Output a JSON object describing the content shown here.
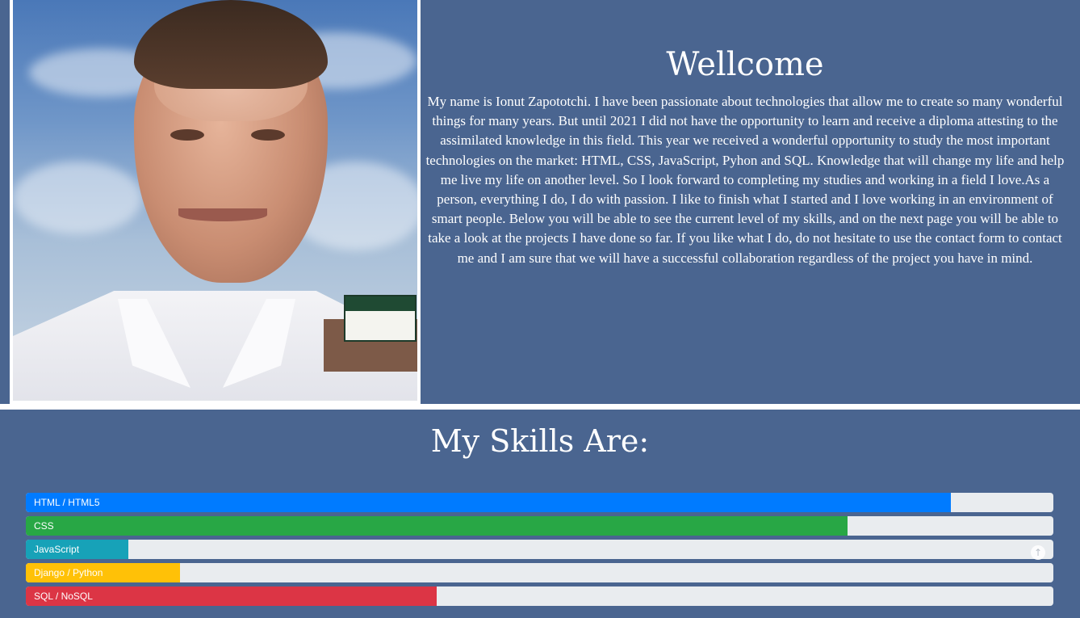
{
  "profile": {
    "photo_alt": "Profile photo"
  },
  "welcome": {
    "title": "Wellcome",
    "text": "My name is Ionut Zapototchi. I have been passionate about technologies that allow me to create so many wonderful things for many years. But until 2021 I did not have the opportunity to learn and receive a diploma attesting to the assimilated knowledge in this field. This year we received a wonderful opportunity to study the most important technologies on the market: HTML, CSS, JavaScript, Pyhon and SQL. Knowledge that will change my life and help me live my life on another level. So I look forward to completing my studies and working in a field I love.As a person, everything I do, I do with passion. I like to finish what I started and I love working in an environment of smart people. Below you will be able to see the current level of my skills, and on the next page you will be able to take a look at the projects I have done so far. If you like what I do, do not hesitate to use the contact form to contact me and I am sure that we will have a successful collaboration regardless of the project you have in mind."
  },
  "skills": {
    "title": "My Skills Are:",
    "items": [
      {
        "label": "HTML / HTML5",
        "percent": 90,
        "color": "#007bff"
      },
      {
        "label": "CSS",
        "percent": 80,
        "color": "#28a745"
      },
      {
        "label": "JavaScript",
        "percent": 10,
        "color": "#17a2b8"
      },
      {
        "label": "Django / Python",
        "percent": 15,
        "color": "#ffc107"
      },
      {
        "label": "SQL / NoSQL",
        "percent": 40,
        "color": "#dc3545"
      }
    ]
  },
  "scroll_top": {
    "icon": "arrow-up-icon",
    "glyph": "↑"
  },
  "colors": {
    "background": "#4a6590",
    "divider": "#ffffff",
    "track": "#e9ecef"
  }
}
